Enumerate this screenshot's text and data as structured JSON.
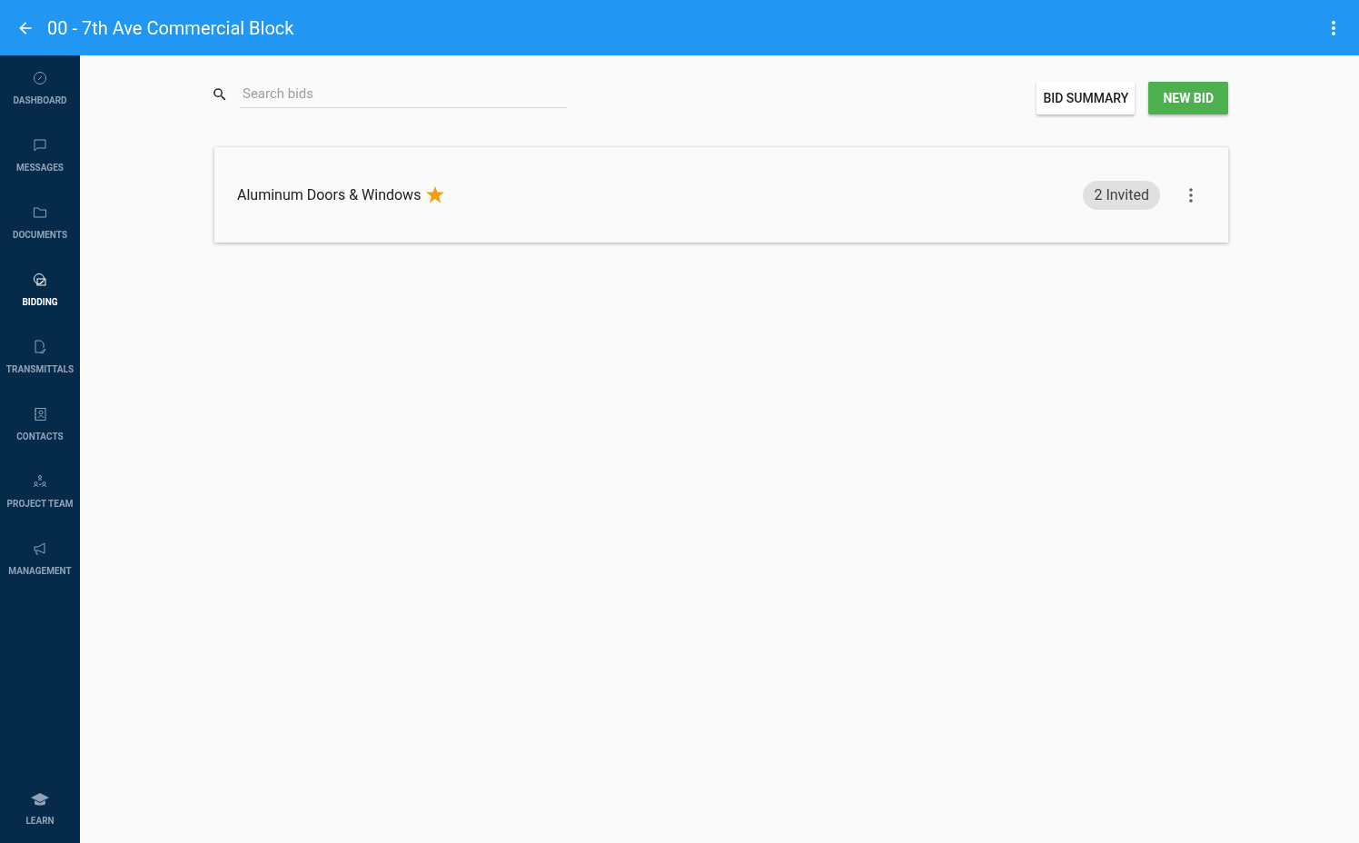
{
  "app_bar": {
    "title": "00 - 7th Ave Commercial Block"
  },
  "sidebar": {
    "items": [
      {
        "label": "DASHBOARD",
        "selected": false
      },
      {
        "label": "MESSAGES",
        "selected": false
      },
      {
        "label": "DOCUMENTS",
        "selected": false
      },
      {
        "label": "BIDDING",
        "selected": true
      },
      {
        "label": "TRANSMITTALS",
        "selected": false
      },
      {
        "label": "CONTACTS",
        "selected": false
      },
      {
        "label": "PROJECT TEAM",
        "selected": false
      },
      {
        "label": "MANAGEMENT",
        "selected": false
      }
    ],
    "footer": {
      "label": "LEARN"
    }
  },
  "search": {
    "placeholder": "Search bids"
  },
  "buttons": [
    {
      "label": "BID SUMMARY",
      "kind": "outlined"
    },
    {
      "label": "NEW BID",
      "kind": "primary"
    }
  ],
  "bids": [
    {
      "name": "Aluminum Doors & Windows",
      "starred": true,
      "invited": "2 Invited"
    }
  ]
}
